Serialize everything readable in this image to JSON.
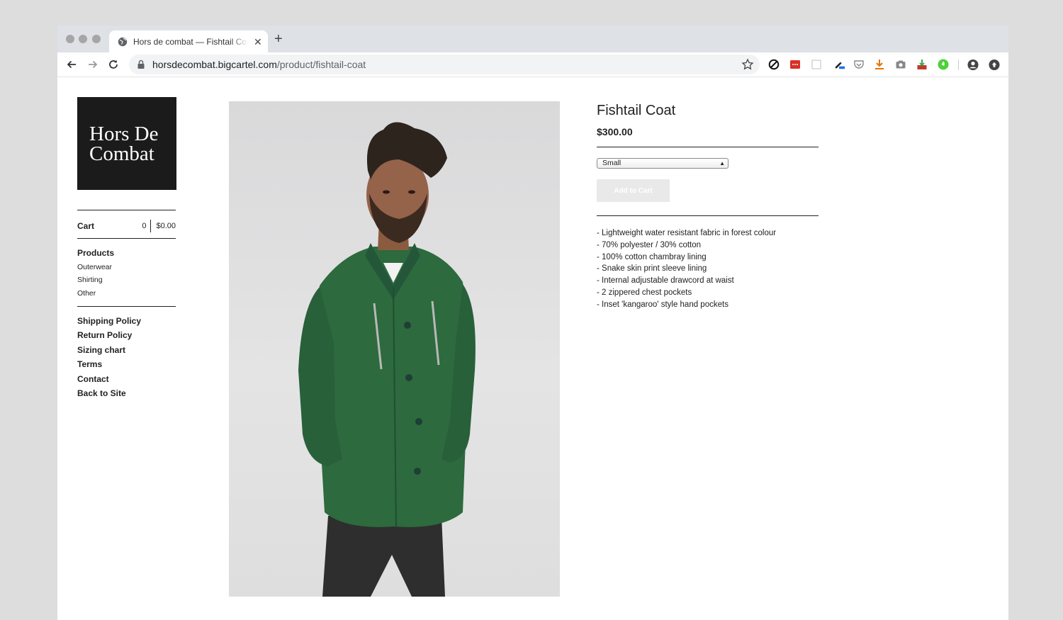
{
  "browser": {
    "tab_title": "Hors de combat — Fishtail Coat",
    "new_tab": "+",
    "close": "✕",
    "url_host": "horsdecombat.bigcartel.com",
    "url_path": "/product/fishtail-coat"
  },
  "icons": {
    "back": "back-arrow-icon",
    "forward": "forward-arrow-icon",
    "reload": "reload-icon",
    "lock": "lock-icon",
    "star": "bookmark-star-icon",
    "extensions": [
      "block-icon",
      "ellipsis-extension-icon",
      "blank-page-icon",
      "pen-extension-icon",
      "pocket-icon",
      "download-arrow-icon",
      "camera-icon",
      "inbox-download-icon",
      "green-extension-icon",
      "profile-icon",
      "upload-circle-icon"
    ]
  },
  "store": {
    "logo_line1": "Hors De",
    "logo_line2": "Combat",
    "cart_label": "Cart",
    "cart_count": "0",
    "cart_total": "$0.00",
    "products_heading": "Products",
    "categories": [
      "Outerwear",
      "Shirting",
      "Other"
    ],
    "links": [
      "Shipping Policy",
      "Return Policy",
      "Sizing chart",
      "Terms",
      "Contact",
      "Back to Site"
    ]
  },
  "product": {
    "title": "Fishtail Coat",
    "price": "$300.00",
    "size_selected": "Small",
    "add_to_cart": "Add to Cart",
    "description": [
      "- Lightweight water resistant fabric in forest colour",
      "- 70% polyester / 30% cotton",
      "- 100% cotton chambray lining",
      "- Snake skin print sleeve lining",
      "- Internal adjustable drawcord at waist",
      "- 2 zippered chest pockets",
      "- Inset 'kangaroo' style hand pockets"
    ]
  },
  "colors": {
    "coat_green": "#2d6a3e",
    "logo_bg": "#1b1b1b",
    "page_bg": "#dddddd"
  }
}
